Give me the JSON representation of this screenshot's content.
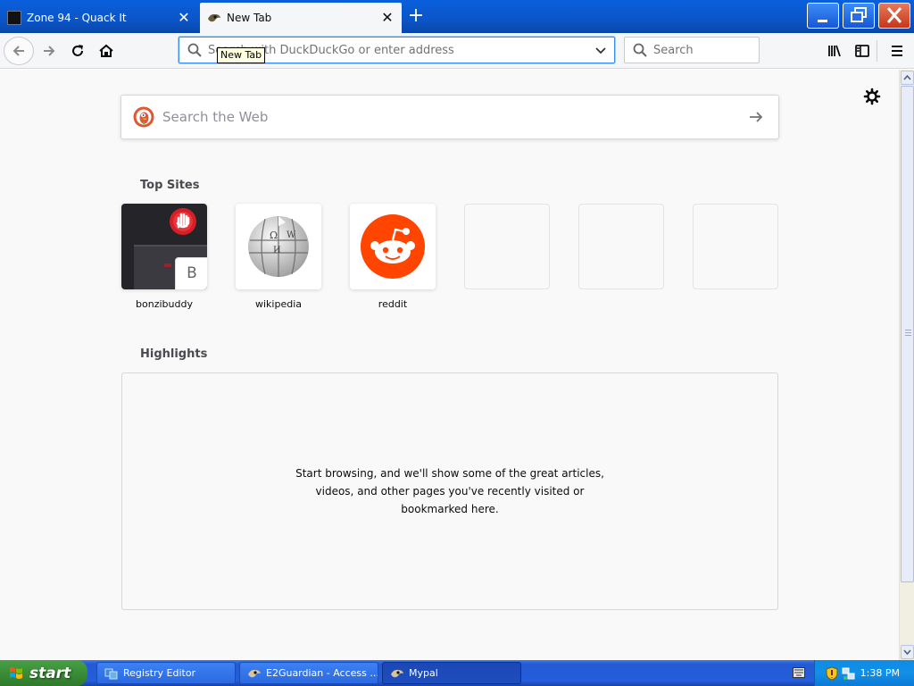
{
  "browser": {
    "tabs": [
      {
        "title": "Zone 94 - Quack It",
        "active": false
      },
      {
        "title": "New Tab",
        "active": true
      }
    ],
    "tooltip": "New Tab",
    "urlbar": {
      "placeholder": "Search with DuckDuckGo or enter address",
      "value": ""
    },
    "searchbar": {
      "placeholder": "Search"
    }
  },
  "newtab": {
    "web_search_placeholder": "Search the Web",
    "top_sites_title": "Top Sites",
    "top_sites": [
      {
        "label": "bonzibuddy",
        "letter": "B"
      },
      {
        "label": "wikipedia"
      },
      {
        "label": "reddit"
      },
      {
        "label": ""
      },
      {
        "label": ""
      },
      {
        "label": ""
      }
    ],
    "highlights_title": "Highlights",
    "highlights_empty": "Start browsing, and we'll show some of the great articles, videos, and other pages you've recently visited or bookmarked here."
  },
  "taskbar": {
    "start_label": "start",
    "tasks": [
      {
        "label": "Registry Editor",
        "active": false
      },
      {
        "label": "E2Guardian - Access ...",
        "active": false
      },
      {
        "label": "Mypal",
        "active": true
      }
    ],
    "clock": "1:38 PM"
  },
  "colors": {
    "titlebar": "#0b55c8",
    "reddit": "#ff4500",
    "duckduckgo": "#de5833",
    "start_green": "#3a8d36",
    "focus_blue": "#3b8fe8"
  }
}
